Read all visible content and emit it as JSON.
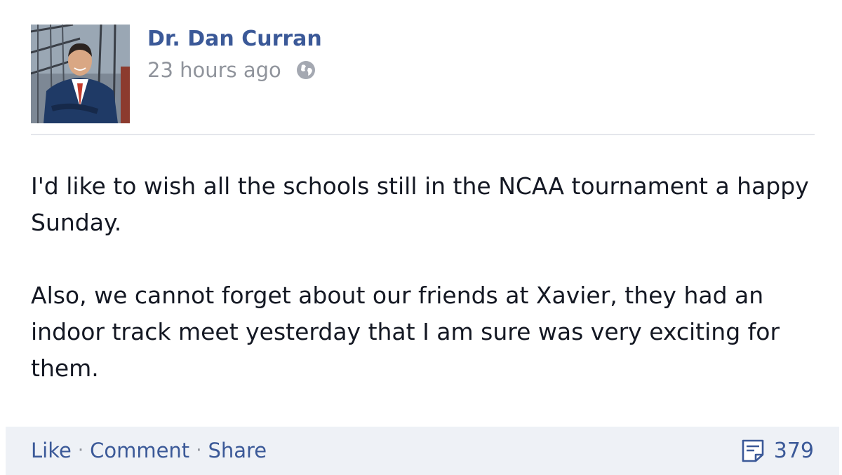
{
  "post": {
    "author": "Dr. Dan Curran",
    "timestamp": "23 hours ago",
    "paragraphs": [
      "I'd like to wish all the schools still in the NCAA tournament a happy Sunday.",
      "Also, we cannot forget about our friends at Xavier, they had an indoor track meet yesterday that I am sure was very exciting for them."
    ]
  },
  "actions": {
    "like_label": "Like",
    "separator": "·",
    "comment_label": "Comment",
    "share_label": "Share",
    "comment_count": "379"
  },
  "icons": {
    "privacy": "globe-icon",
    "comments": "comment-bubble-icon"
  },
  "colors": {
    "link": "#3b5998",
    "meta_text": "#90949c",
    "body_text": "#141823",
    "actions_background": "#eef1f6"
  }
}
